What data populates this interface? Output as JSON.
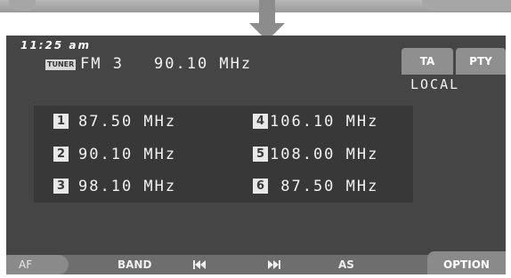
{
  "status": {
    "time": "11:25 am"
  },
  "tuner": {
    "source_badge": "TUNER",
    "band": "FM 3",
    "frequency": "90.10 MHz",
    "local_indicator": "LOCAL"
  },
  "buttons": {
    "ta": "TA",
    "pty": "PTY"
  },
  "presets": [
    {
      "number": "1",
      "frequency": "87.50 MHz"
    },
    {
      "number": "2",
      "frequency": "90.10 MHz"
    },
    {
      "number": "3",
      "frequency": "98.10 MHz"
    },
    {
      "number": "4",
      "frequency": "106.10 MHz"
    },
    {
      "number": "5",
      "frequency": "108.00 MHz"
    },
    {
      "number": "6",
      "frequency": " 87.50 MHz"
    }
  ],
  "bottom_bar": {
    "af": "AF",
    "band": "BAND",
    "seek_prev_icon": "skip-back-icon",
    "seek_next_icon": "skip-forward-icon",
    "as": "AS",
    "option": "OPTION"
  },
  "colors": {
    "screen_bg": "#454545",
    "panel_bg": "#383838",
    "text": "#f2f2f2",
    "button_bg": "#8f8f8f"
  }
}
